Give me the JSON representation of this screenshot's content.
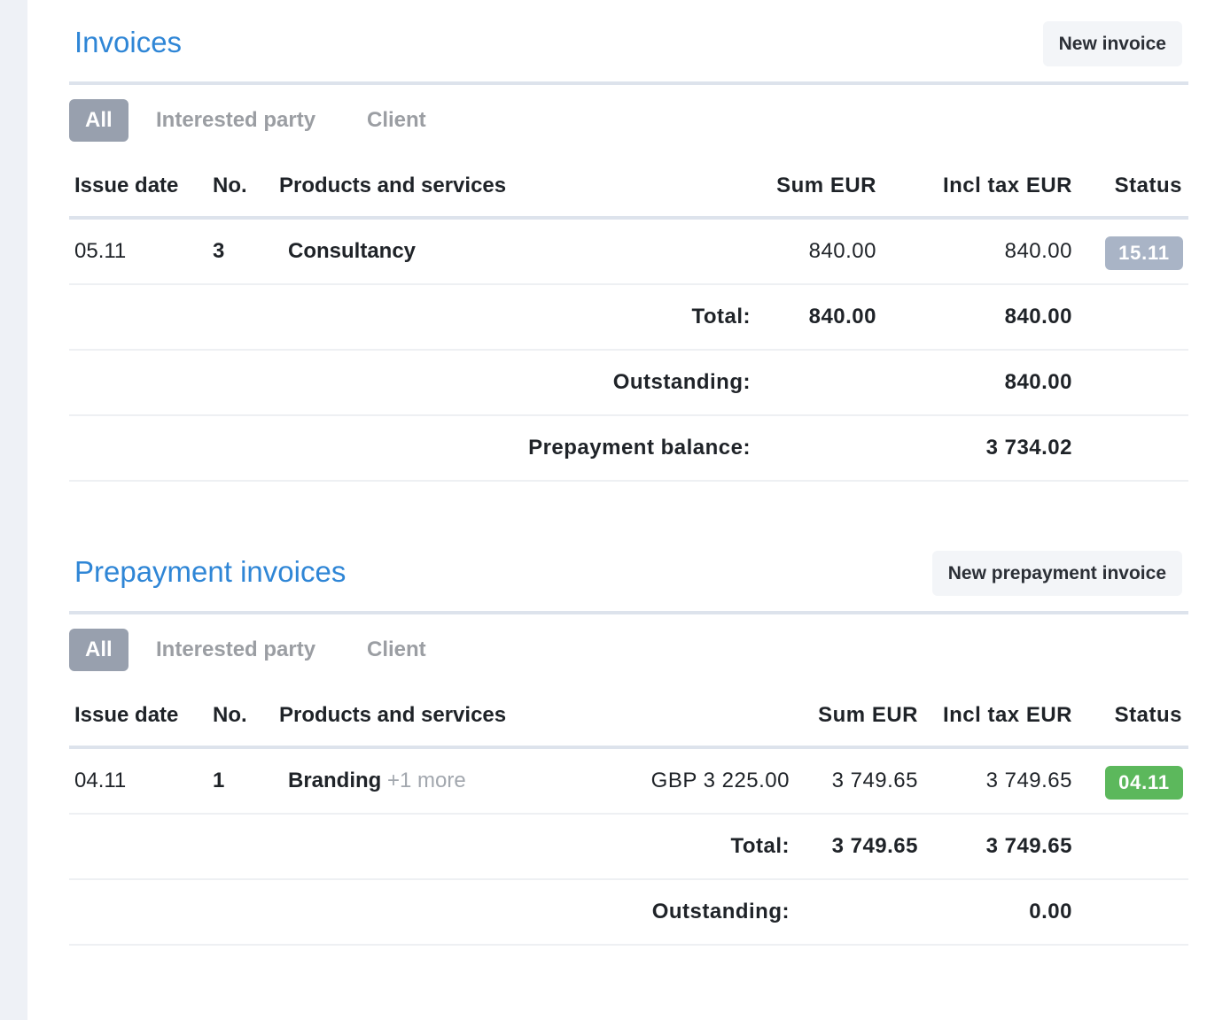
{
  "invoices": {
    "title": "Invoices",
    "new_button": "New invoice",
    "filters": [
      "All",
      "Interested party",
      "Client"
    ],
    "columns": {
      "issue_date": "Issue date",
      "no": "No.",
      "products": "Products and services",
      "sum": "Sum EUR",
      "incl_tax": "Incl tax EUR",
      "status": "Status"
    },
    "rows": [
      {
        "issue_date": "05.11",
        "no": "3",
        "product": "Consultancy",
        "sum": "840.00",
        "incl_tax": "840.00",
        "status": "15.11",
        "status_color": "#a9b4c6"
      }
    ],
    "summary": {
      "total_label": "Total:",
      "total_sum": "840.00",
      "total_incl": "840.00",
      "outstanding_label": "Outstanding:",
      "outstanding_incl": "840.00",
      "prepayment_label": "Prepayment balance:",
      "prepayment_incl": "3 734.02"
    }
  },
  "prepayment": {
    "title": "Prepayment invoices",
    "new_button": "New prepayment invoice",
    "filters": [
      "All",
      "Interested party",
      "Client"
    ],
    "columns": {
      "issue_date": "Issue date",
      "no": "No.",
      "products": "Products and services",
      "sum": "Sum EUR",
      "incl_tax": "Incl tax EUR",
      "status": "Status"
    },
    "rows": [
      {
        "issue_date": "04.11",
        "no": "1",
        "product": "Branding",
        "product_more": "+1 more",
        "currency_amount": "GBP 3 225.00",
        "sum": "3 749.65",
        "incl_tax": "3 749.65",
        "status": "04.11",
        "status_color": "#5cb85c"
      }
    ],
    "summary": {
      "total_label": "Total:",
      "total_sum": "3 749.65",
      "total_incl": "3 749.65",
      "outstanding_label": "Outstanding:",
      "outstanding_incl": "0.00"
    }
  }
}
